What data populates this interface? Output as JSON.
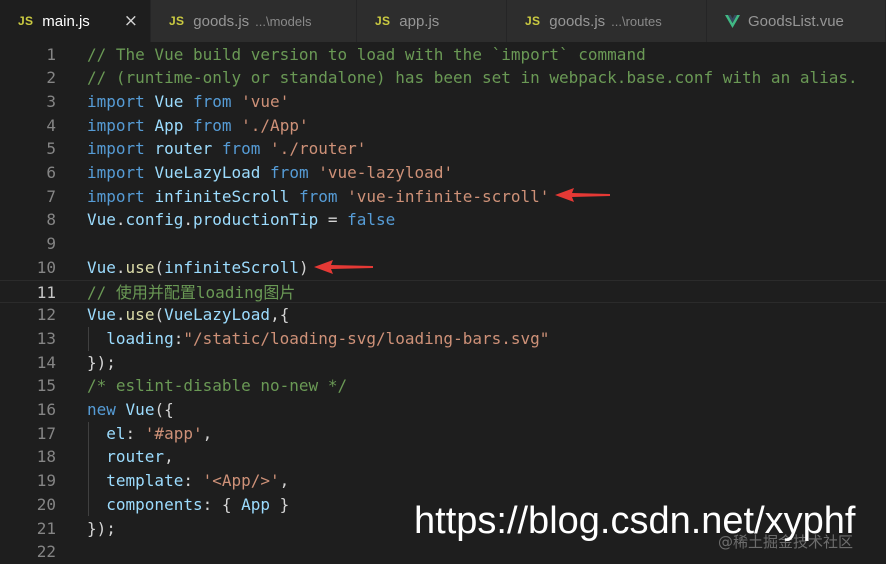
{
  "tabs": [
    {
      "label": "main.js",
      "badge": "JS",
      "desc": "",
      "active": true,
      "close": "×"
    },
    {
      "label": "goods.js",
      "badge": "JS",
      "desc": "...\\models",
      "active": false
    },
    {
      "label": "app.js",
      "badge": "JS",
      "desc": "",
      "active": false
    },
    {
      "label": "goods.js",
      "badge": "JS",
      "desc": "...\\routes",
      "active": false
    },
    {
      "label": "GoodsList.vue",
      "badge": "vue-logo",
      "desc": "",
      "active": false
    }
  ],
  "editor": {
    "current_line": 11,
    "lines": [
      {
        "n": "1",
        "tokens": [
          [
            "cm",
            "// The Vue build version to load with the `import` command"
          ]
        ]
      },
      {
        "n": "2",
        "tokens": [
          [
            "cm",
            "// (runtime-only or standalone) has been set in webpack.base.conf with an alias."
          ]
        ]
      },
      {
        "n": "3",
        "tokens": [
          [
            "kw",
            "import"
          ],
          [
            "pu",
            " "
          ],
          [
            "id",
            "Vue"
          ],
          [
            "pu",
            " "
          ],
          [
            "kw",
            "from"
          ],
          [
            "pu",
            " "
          ],
          [
            "str",
            "'vue'"
          ]
        ]
      },
      {
        "n": "4",
        "tokens": [
          [
            "kw",
            "import"
          ],
          [
            "pu",
            " "
          ],
          [
            "id",
            "App"
          ],
          [
            "pu",
            " "
          ],
          [
            "kw",
            "from"
          ],
          [
            "pu",
            " "
          ],
          [
            "str",
            "'./App'"
          ]
        ]
      },
      {
        "n": "5",
        "tokens": [
          [
            "kw",
            "import"
          ],
          [
            "pu",
            " "
          ],
          [
            "id",
            "router"
          ],
          [
            "pu",
            " "
          ],
          [
            "kw",
            "from"
          ],
          [
            "pu",
            " "
          ],
          [
            "str",
            "'./router'"
          ]
        ]
      },
      {
        "n": "6",
        "tokens": [
          [
            "kw",
            "import"
          ],
          [
            "pu",
            " "
          ],
          [
            "id",
            "VueLazyLoad"
          ],
          [
            "pu",
            " "
          ],
          [
            "kw",
            "from"
          ],
          [
            "pu",
            " "
          ],
          [
            "str",
            "'vue-lazyload'"
          ]
        ]
      },
      {
        "n": "7",
        "tokens": [
          [
            "kw",
            "import"
          ],
          [
            "pu",
            " "
          ],
          [
            "id",
            "infiniteScroll"
          ],
          [
            "pu",
            " "
          ],
          [
            "kw",
            "from"
          ],
          [
            "pu",
            " "
          ],
          [
            "str",
            "'vue-infinite-scroll'"
          ]
        ]
      },
      {
        "n": "8",
        "tokens": [
          [
            "id",
            "Vue"
          ],
          [
            "pu",
            "."
          ],
          [
            "id",
            "config"
          ],
          [
            "pu",
            "."
          ],
          [
            "id",
            "productionTip"
          ],
          [
            "pu",
            " = "
          ],
          [
            "kw",
            "false"
          ]
        ]
      },
      {
        "n": "9",
        "tokens": []
      },
      {
        "n": "10",
        "tokens": [
          [
            "id",
            "Vue"
          ],
          [
            "pu",
            "."
          ],
          [
            "fn",
            "use"
          ],
          [
            "pu",
            "("
          ],
          [
            "id",
            "infiniteScroll"
          ],
          [
            "pu",
            ")"
          ]
        ]
      },
      {
        "n": "11",
        "tokens": [
          [
            "cm",
            "// 使用并配置loading图片"
          ]
        ]
      },
      {
        "n": "12",
        "tokens": [
          [
            "id",
            "Vue"
          ],
          [
            "pu",
            "."
          ],
          [
            "fn",
            "use"
          ],
          [
            "pu",
            "("
          ],
          [
            "id",
            "VueLazyLoad"
          ],
          [
            "pu",
            ",{"
          ]
        ]
      },
      {
        "n": "13",
        "indent": true,
        "tokens": [
          [
            "pu",
            "  "
          ],
          [
            "id",
            "loading"
          ],
          [
            "pu",
            ":"
          ],
          [
            "str",
            "\"/static/loading-svg/loading-bars.svg\""
          ]
        ]
      },
      {
        "n": "14",
        "tokens": [
          [
            "pu",
            "});"
          ]
        ]
      },
      {
        "n": "15",
        "tokens": [
          [
            "cm",
            "/* eslint-disable no-new */"
          ]
        ]
      },
      {
        "n": "16",
        "tokens": [
          [
            "kw",
            "new"
          ],
          [
            "pu",
            " "
          ],
          [
            "id",
            "Vue"
          ],
          [
            "pu",
            "({"
          ]
        ]
      },
      {
        "n": "17",
        "indent": true,
        "tokens": [
          [
            "pu",
            "  "
          ],
          [
            "id",
            "el"
          ],
          [
            "pu",
            ": "
          ],
          [
            "str",
            "'#app'"
          ],
          [
            "pu",
            ","
          ]
        ]
      },
      {
        "n": "18",
        "indent": true,
        "tokens": [
          [
            "pu",
            "  "
          ],
          [
            "id",
            "router"
          ],
          [
            "pu",
            ","
          ]
        ]
      },
      {
        "n": "19",
        "indent": true,
        "tokens": [
          [
            "pu",
            "  "
          ],
          [
            "id",
            "template"
          ],
          [
            "pu",
            ": "
          ],
          [
            "str",
            "'<App/>'"
          ],
          [
            "pu",
            ","
          ]
        ]
      },
      {
        "n": "20",
        "indent": true,
        "tokens": [
          [
            "pu",
            "  "
          ],
          [
            "id",
            "components"
          ],
          [
            "pu",
            ": { "
          ],
          [
            "id",
            "App"
          ],
          [
            "pu",
            " }"
          ]
        ]
      },
      {
        "n": "21",
        "tokens": [
          [
            "pu",
            "});"
          ]
        ]
      },
      {
        "n": "22",
        "tokens": []
      }
    ]
  },
  "annotations": {
    "arrow_color": "#e53935"
  },
  "watermark": {
    "text": "https://blog.csdn.net/xyphf",
    "sub": "@稀土掘金技术社区"
  },
  "colors": {
    "background": "#1e1e1e",
    "keyword": "#569cd6",
    "identifier": "#9cdcfe",
    "string": "#ce9178",
    "comment": "#6a9955",
    "function": "#dcdcaa"
  }
}
